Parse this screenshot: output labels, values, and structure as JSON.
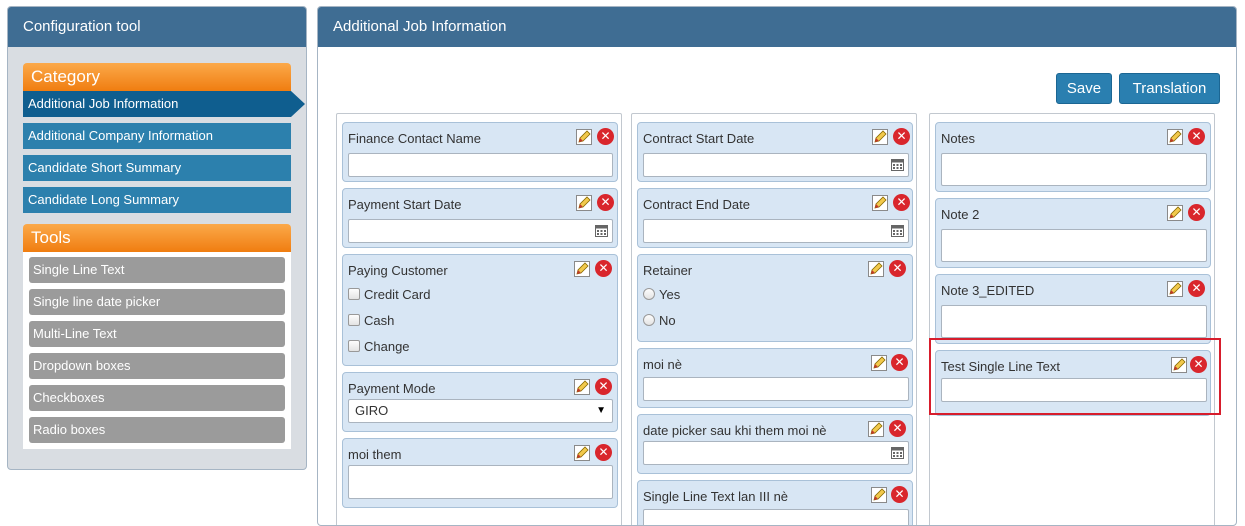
{
  "left_panel": {
    "title": "Configuration tool",
    "category": {
      "heading": "Category",
      "items": [
        {
          "label": "Additional Job Information"
        },
        {
          "label": "Additional Company Information"
        },
        {
          "label": "Candidate Short Summary"
        },
        {
          "label": "Candidate Long Summary"
        }
      ]
    },
    "tools": {
      "heading": "Tools",
      "items": [
        {
          "label": "Single Line Text"
        },
        {
          "label": "Single line date picker"
        },
        {
          "label": "Multi-Line Text"
        },
        {
          "label": "Dropdown boxes"
        },
        {
          "label": "Checkboxes"
        },
        {
          "label": "Radio boxes"
        }
      ]
    }
  },
  "main": {
    "title": "Additional Job Information",
    "save_label": "Save",
    "translation_label": "Translation",
    "col1": {
      "finance_contact": {
        "label": "Finance Contact Name",
        "value": ""
      },
      "payment_start": {
        "label": "Payment Start Date",
        "value": ""
      },
      "paying_customer": {
        "label": "Paying Customer",
        "options": [
          "Credit Card",
          "Cash",
          "Change"
        ]
      },
      "payment_mode": {
        "label": "Payment Mode",
        "selected": "GIRO"
      },
      "moi_them": {
        "label": "moi them",
        "value": ""
      }
    },
    "col2": {
      "contract_start": {
        "label": "Contract Start Date",
        "value": ""
      },
      "contract_end": {
        "label": "Contract End Date",
        "value": ""
      },
      "retainer": {
        "label": "Retainer",
        "options": [
          "Yes",
          "No"
        ]
      },
      "moi_ne": {
        "label": "moi nè",
        "value": ""
      },
      "date_picker_moi": {
        "label": "date picker sau khi them moi nè",
        "value": ""
      },
      "single_line_iii": {
        "label": "Single Line Text lan III nè",
        "value": ""
      }
    },
    "col3": {
      "notes": {
        "label": "Notes",
        "value": ""
      },
      "note2": {
        "label": "Note 2",
        "value": ""
      },
      "note3": {
        "label": "Note 3_EDITED",
        "value": ""
      },
      "test_single": {
        "label": "Test Single Line Text",
        "value": ""
      }
    }
  },
  "colors": {
    "header": "#3f6d93",
    "category_active": "#0f5e8f",
    "category_item": "#2c80ad",
    "orange": "#f07d10",
    "tool_item": "#9b9b9b",
    "field_bg": "#d8e6f4",
    "delete_red": "#d9262c",
    "highlight_red": "#d71d2c"
  },
  "icons": {
    "edit": "pencil-edit-icon",
    "delete": "red-x-circle-icon",
    "calendar": "calendar-icon",
    "dropdown": "triangle-down-icon"
  }
}
